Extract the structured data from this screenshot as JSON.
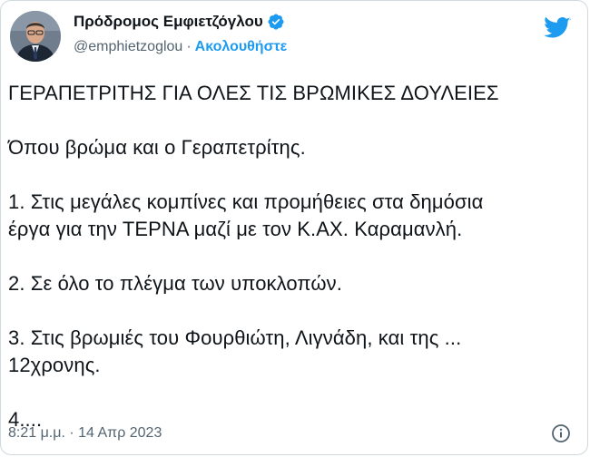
{
  "tweet": {
    "display_name": "Πρόδρομος Εμφιετζόγλου",
    "handle": "@emphietzoglou",
    "separator": "·",
    "follow_label": "Ακολουθήστε",
    "text": "ΓΕΡΑΠΕΤΡΙΤΗΣ ΓΙΑ ΟΛΕΣ ΤΙΣ ΒΡΩΜΙΚΕΣ ΔΟΥΛΕΙΕΣ\n\nΌπου βρώμα και ο Γεραπετρίτης.\n\n1. Στις μεγάλες κομπίνες και προμήθειες στα δημόσια\nέργα για την ΤΕΡΝΑ μαζί με τον Κ.ΑΧ. Καραμανλή.\n\n2. Σε όλο το πλέγμα των υποκλοπών.\n\n3. Στις βρωμιές του Φουρθιώτη, Λιγνάδη, και της ...\n12χρονης.\n\n4....",
    "timestamp": "8:21 μ.μ. · 14 Απρ 2023"
  },
  "icons": {
    "verified": "verified-badge-icon",
    "brand": "twitter-bird-icon",
    "info": "info-icon"
  },
  "colors": {
    "accent": "#1d9bf0",
    "text": "#0f1419",
    "secondary": "#536471",
    "border": "#cfd9de"
  }
}
